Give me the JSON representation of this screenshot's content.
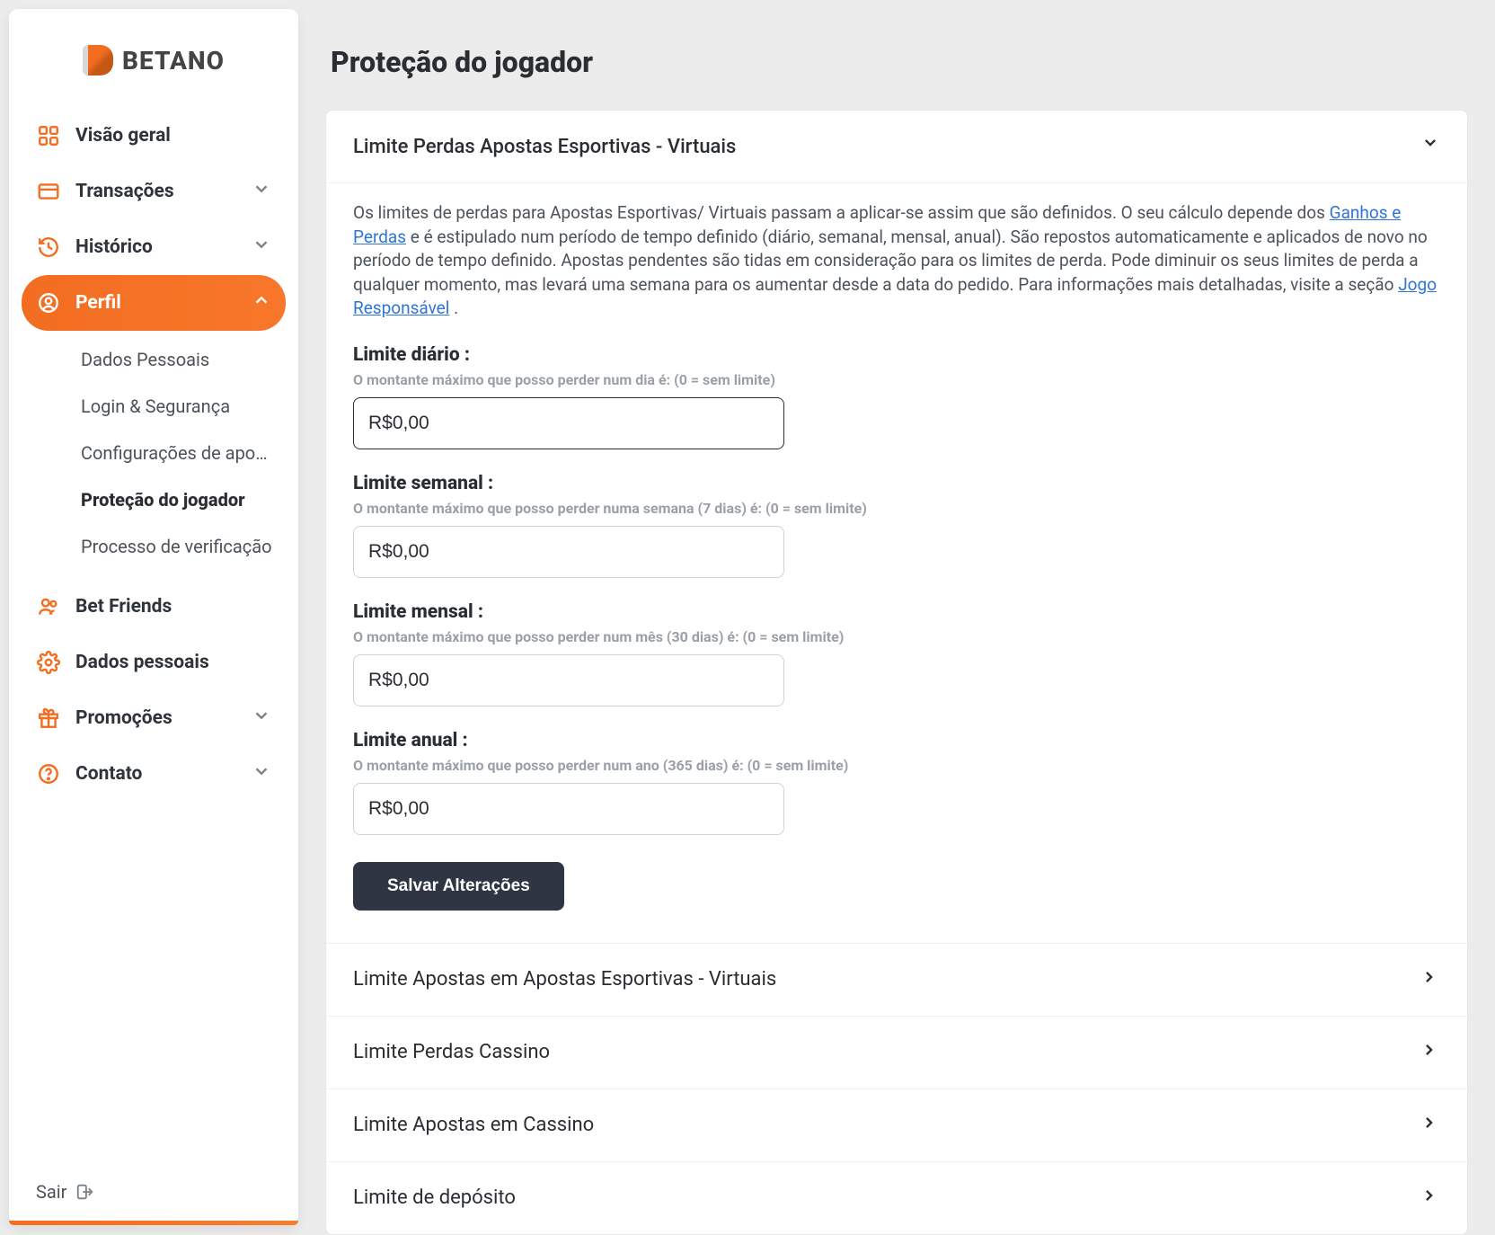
{
  "brand": {
    "name": "BETANO"
  },
  "sidebar": {
    "items": [
      {
        "label": "Visão geral",
        "icon": "grid"
      },
      {
        "label": "Transações",
        "icon": "card",
        "chevron": true
      },
      {
        "label": "Histórico",
        "icon": "history",
        "chevron": true
      },
      {
        "label": "Perfil",
        "icon": "user",
        "chevron": true,
        "active": true
      },
      {
        "label": "Bet Friends",
        "icon": "friends"
      },
      {
        "label": "Dados pessoais",
        "icon": "gear"
      },
      {
        "label": "Promoções",
        "icon": "gift",
        "chevron": true
      },
      {
        "label": "Contato",
        "icon": "help",
        "chevron": true
      }
    ],
    "profile_sub": [
      "Dados Pessoais",
      "Login & Segurança",
      "Configurações de apos…",
      "Proteção do jogador",
      "Processo de verificação"
    ],
    "logout": "Sair"
  },
  "page": {
    "title": "Proteção do jogador"
  },
  "panel": {
    "title": "Limite Perdas Apostas Esportivas - Virtuais",
    "info_pre": "Os limites de perdas para Apostas Esportivas/ Virtuais passam a aplicar-se assim que são definidos. O seu cálculo depende dos ",
    "info_link1": "Ganhos e Perdas",
    "info_mid": " e é estipulado num período de tempo definido (diário, semanal, mensal, anual). São repostos automaticamente e aplicados de novo no período de tempo definido. Apostas pendentes são tidas em consideração para os limites de perda. Pode diminuir os seus limites de perda a qualquer momento, mas levará uma semana para os aumentar desde a data do pedido. Para informações mais detalhadas, visite a seção ",
    "info_link2": "Jogo Responsável",
    "info_post": ".",
    "fields": [
      {
        "label": "Limite diário :",
        "hint": "O montante máximo que posso perder num dia é: (0 = sem limite)",
        "value": "R$0,00",
        "focus": true
      },
      {
        "label": "Limite semanal :",
        "hint": "O montante máximo que posso perder numa semana (7 dias) é: (0 = sem limite)",
        "value": "R$0,00"
      },
      {
        "label": "Limite mensal :",
        "hint": "O montante máximo que posso perder num mês (30 dias) é: (0 = sem limite)",
        "value": "R$0,00"
      },
      {
        "label": "Limite anual :",
        "hint": "O montante máximo que posso perder num ano (365 dias) é: (0 = sem limite)",
        "value": "R$0,00"
      }
    ],
    "save": "Salvar Alterações"
  },
  "rows": [
    "Limite Apostas em Apostas Esportivas - Virtuais",
    "Limite Perdas Cassino",
    "Limite Apostas em Cassino",
    "Limite de depósito"
  ]
}
